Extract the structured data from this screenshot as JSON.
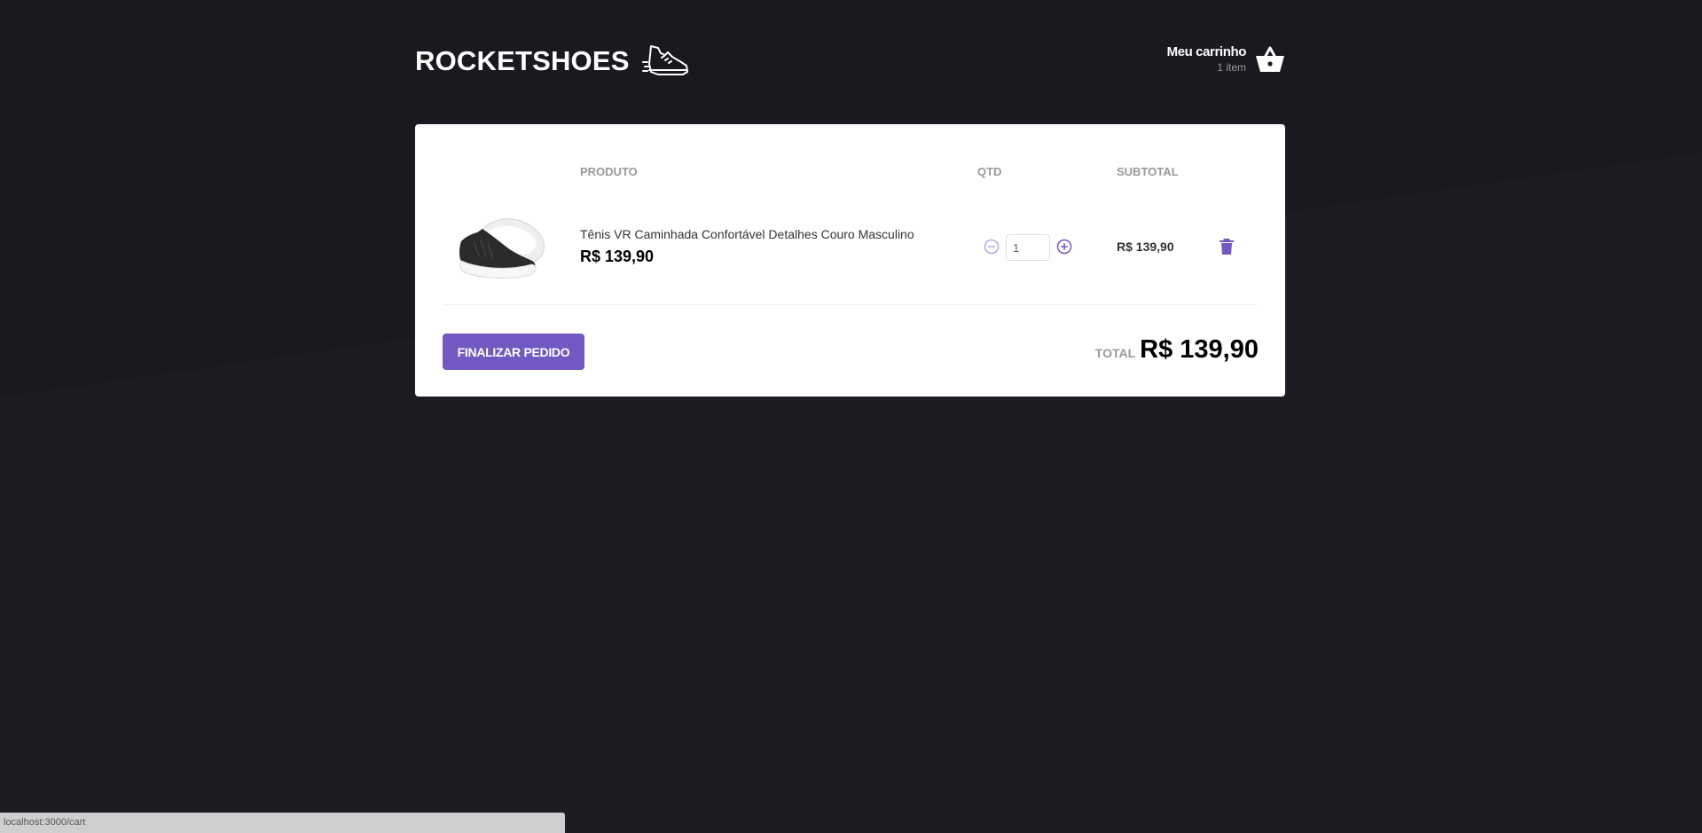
{
  "header": {
    "logo_text": "ROCKETSHOES",
    "cart_title": "Meu carrinho",
    "cart_count": "1 item"
  },
  "table": {
    "columns": [
      "PRODUTO",
      "QTD",
      "SUBTOTAL"
    ],
    "rows": [
      {
        "name": "Tênis VR Caminhada Confortável Detalhes Couro Masculino",
        "price": "R$ 139,90",
        "quantity": "1",
        "subtotal": "R$ 139,90"
      }
    ]
  },
  "footer": {
    "finish_label": "FINALIZAR PEDIDO",
    "total_label": "TOTAL",
    "total_value": "R$ 139,90"
  },
  "status_bar": {
    "url": "localhost:3000/cart"
  },
  "colors": {
    "accent": "#7159c1",
    "background": "#191920"
  },
  "icons": {
    "logo": "running-shoe-icon",
    "cart": "basket-icon",
    "decrement": "minus-circle-icon",
    "increment": "plus-circle-icon",
    "delete": "trash-icon"
  }
}
